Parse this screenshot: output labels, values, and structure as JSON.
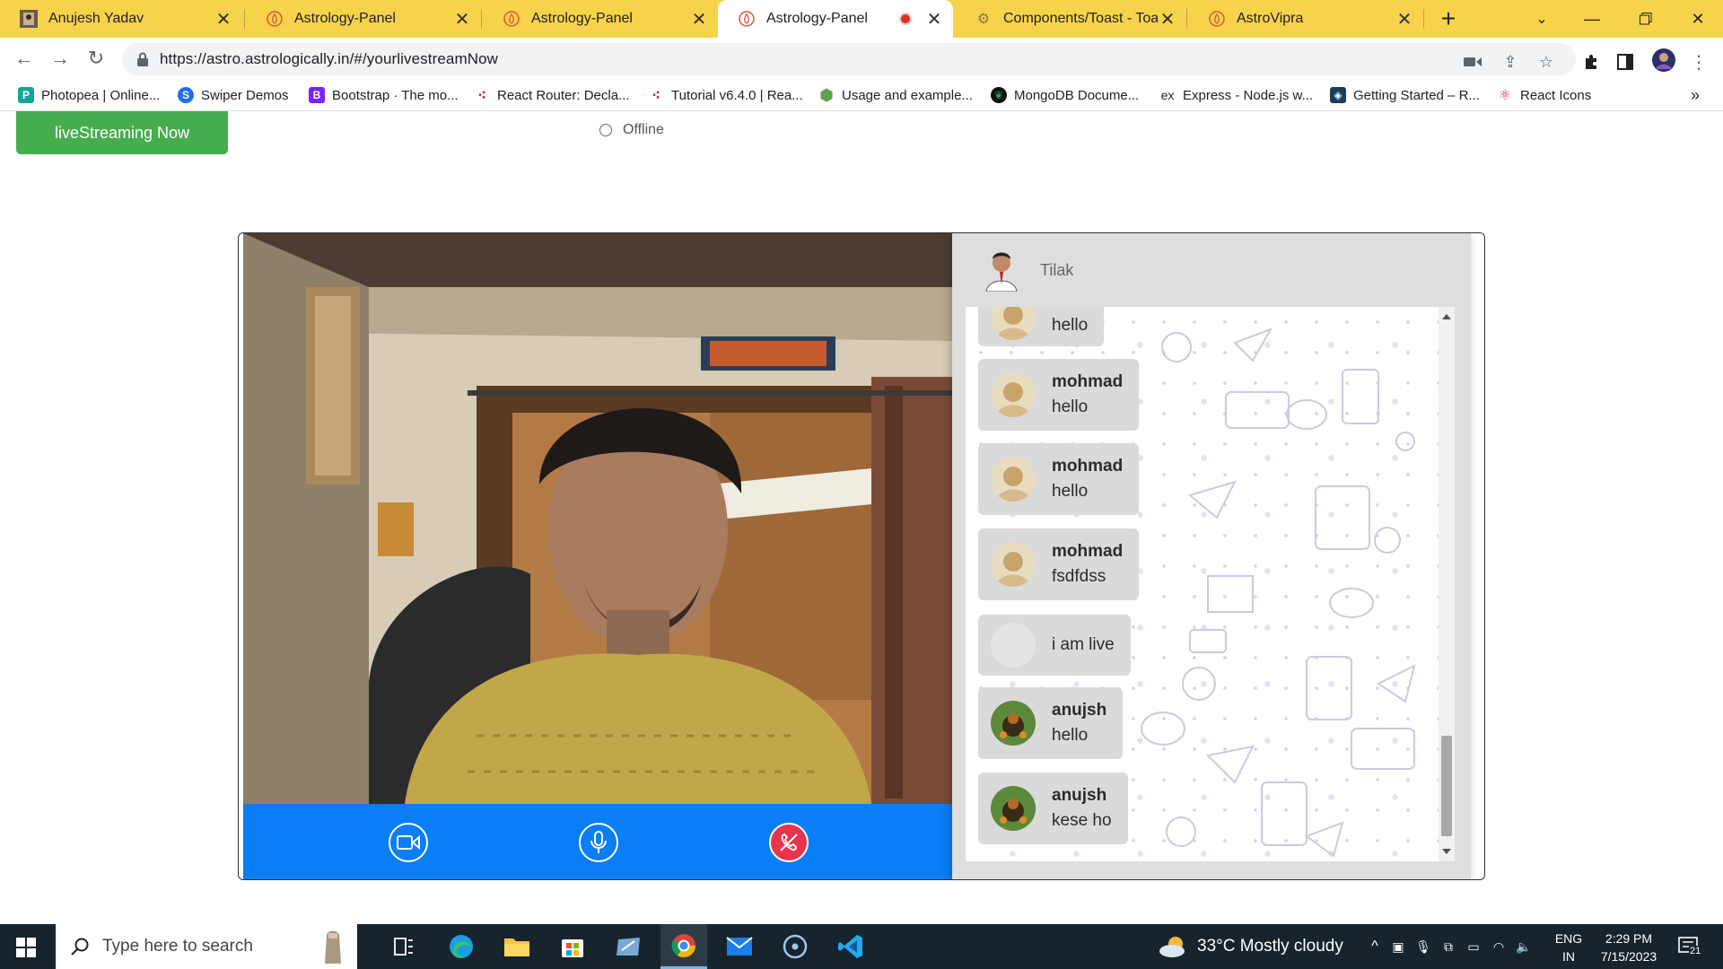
{
  "browser": {
    "tabs": [
      {
        "title": "Anujesh Yadav",
        "icon": "profile-photo-icon",
        "active": false
      },
      {
        "title": "Astrology-Panel",
        "icon": "astro-flame-icon",
        "active": false
      },
      {
        "title": "Astrology-Panel",
        "icon": "astro-flame-icon",
        "active": false
      },
      {
        "title": "Astrology-Panel",
        "icon": "astro-flame-icon",
        "active": true,
        "recording": true
      },
      {
        "title": "Components/Toast - Toast",
        "icon": "gear-icon",
        "active": false
      },
      {
        "title": "AstroVipra",
        "icon": "astro-flame-icon",
        "active": false
      }
    ],
    "url": "https://astro.astrologically.in/#/yourlivestreamNow",
    "bookmarks": [
      {
        "label": "Photopea | Online...",
        "icon": "photopea-icon",
        "color": "#18a497"
      },
      {
        "label": "Swiper Demos",
        "icon": "swiper-icon",
        "color": "#1e6ff1"
      },
      {
        "label": "Bootstrap · The mo...",
        "icon": "bootstrap-icon",
        "color": "#7b21f4"
      },
      {
        "label": "React Router: Decla...",
        "icon": "react-router-icon",
        "color": "#d0021b"
      },
      {
        "label": "Tutorial v6.4.0 | Rea...",
        "icon": "react-router-icon",
        "color": "#d0021b"
      },
      {
        "label": "Usage and example...",
        "icon": "hexagon-icon",
        "color": "#5fa04e"
      },
      {
        "label": "MongoDB Docume...",
        "icon": "mongodb-leaf-icon",
        "color": "#13aa52"
      },
      {
        "label": "Express - Node.js w...",
        "icon": "express-icon",
        "color": "#222222"
      },
      {
        "label": "Getting Started – R...",
        "icon": "redux-icon",
        "color": "#1b3e5b"
      },
      {
        "label": "React Icons",
        "icon": "react-icon",
        "color": "#e91e63"
      }
    ],
    "bookmarks_overflow": "»"
  },
  "page": {
    "live_button": "liveStreaming Now",
    "status_label": "Offline"
  },
  "chat": {
    "header_name": "Tilak",
    "messages": [
      {
        "name": "",
        "text": "hello",
        "avatar": "mohmad-avatar"
      },
      {
        "name": "mohmad",
        "text": "hello",
        "avatar": "mohmad-avatar"
      },
      {
        "name": "mohmad",
        "text": "hello",
        "avatar": "mohmad-avatar"
      },
      {
        "name": "mohmad",
        "text": "fsdfdss",
        "avatar": "mohmad-avatar"
      },
      {
        "name": "",
        "text": "i am live",
        "avatar": "blank-avatar"
      },
      {
        "name": "anujsh",
        "text": "hello",
        "avatar": "anujsh-avatar"
      },
      {
        "name": "anujsh",
        "text": "kese ho",
        "avatar": "anujsh-avatar"
      }
    ]
  },
  "controls": {
    "accent": "#0a7ef7",
    "end_call_color": "#e8354d"
  },
  "taskbar": {
    "search_placeholder": "Type here to search",
    "weather": "33°C  Mostly cloudy",
    "lang_top": "ENG",
    "lang_bottom": "IN",
    "time": "2:29 PM",
    "date": "7/15/2023",
    "notifications": "21"
  }
}
